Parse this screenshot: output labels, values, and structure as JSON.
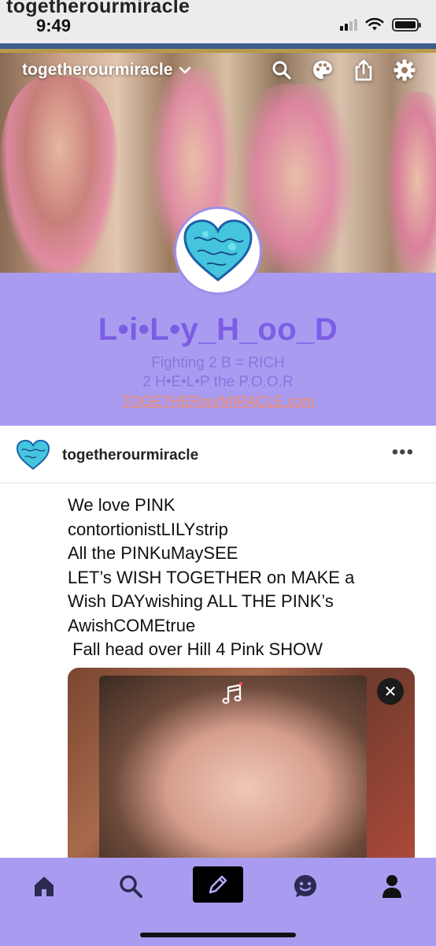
{
  "overlay": {
    "title": "togetherourmiracle"
  },
  "status_bar": {
    "time": "9:49"
  },
  "header": {
    "blog_switcher_label": "togetherourmiracle",
    "icons": [
      "search-icon",
      "palette-icon",
      "share-icon",
      "gear-icon"
    ]
  },
  "profile": {
    "title": "L•i•L•y_H_oo_D",
    "description_line1": "Fighting 2 B = RICH",
    "description_line2": "2 H•E•L•P the P.O.O.R",
    "link": "TOGETHERourMIRACLE.com"
  },
  "post": {
    "blog_name": "togetherourmiracle",
    "menu_label": "•••",
    "lines": [
      "We love PINK",
      "contortionistLILYstrip",
      "All the PINKuMaySEE",
      "LET’s WISH TOGETHER on MAKE a",
      "Wish DAYwishing ALL THE PINK’s",
      "AwishCOMEtrue",
      " Fall head over Hill 4 Pink SHOW"
    ],
    "media_close_label": "✕"
  },
  "tabbar": {
    "tabs": [
      "home-icon",
      "search-icon",
      "compose-icon",
      "activity-icon",
      "account-icon"
    ]
  },
  "colors": {
    "accent_purple": "#a99cf0",
    "title_purple": "#7b5de6",
    "link_orange": "#f48b6a"
  }
}
